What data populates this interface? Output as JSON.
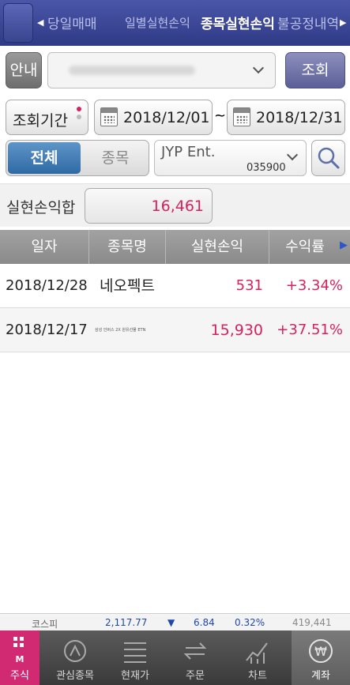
{
  "top_tabs": {
    "items": [
      "당일매매",
      "일별실현손익",
      "종목실현손익",
      "불공정내역"
    ],
    "active_index": 2
  },
  "guide": {
    "label": "안내",
    "search_label": "조회"
  },
  "period": {
    "label": "조회기간",
    "start_date": "2018/12/01",
    "separator": "~",
    "end_date": "2018/12/31"
  },
  "filter": {
    "all_label": "전체",
    "stock_label": "종목",
    "stock_name": "JYP Ent.",
    "stock_code": "035900"
  },
  "summary": {
    "label": "실현손익합",
    "value": "16,461"
  },
  "table": {
    "headers": [
      "일자",
      "종목명",
      "실현손익",
      "수익률"
    ],
    "rows": [
      {
        "date": "2018/12/28",
        "name": "네오펙트",
        "pnl": "531",
        "rate": "+3.34%"
      },
      {
        "date": "2018/12/17",
        "name": "삼성 인버스 2X 원유선물 ETN",
        "pnl": "15,930",
        "rate": "+37.51%"
      }
    ]
  },
  "ticker": {
    "index_name": "코스피",
    "value": "2,117.77",
    "direction": "▼",
    "change": "6.84",
    "percent": "0.32%",
    "volume": "419,441"
  },
  "bottom_nav": {
    "brand_label": "주식",
    "items": [
      "관심종목",
      "현재가",
      "주문",
      "차트",
      "계좌"
    ],
    "active_index": 4
  },
  "colors": {
    "header": "#2f3a86",
    "accent_pink": "#d4235c",
    "segment_blue": "#2f6aa5",
    "brand": "#d22a72"
  }
}
